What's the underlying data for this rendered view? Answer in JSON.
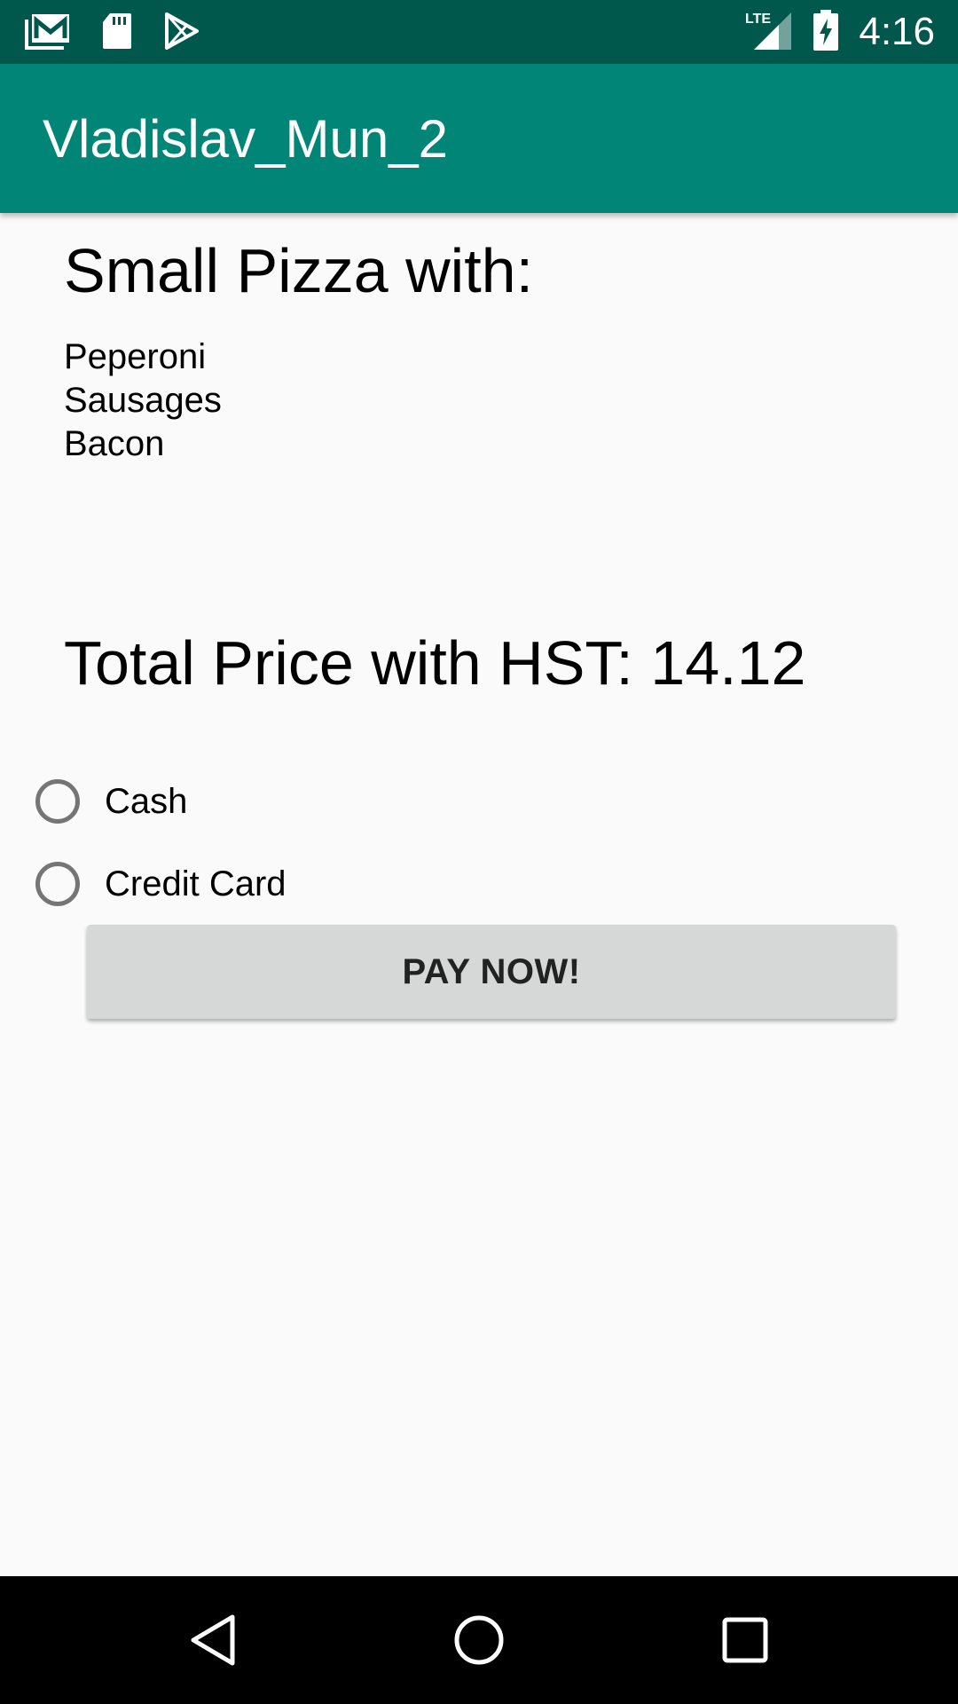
{
  "status_bar": {
    "time": "4:16",
    "network_label": "LTE",
    "left_icons": [
      "gmail-icon",
      "sd-card-icon",
      "play-store-icon"
    ],
    "right_icons": [
      "lte-signal-icon",
      "battery-charging-icon"
    ],
    "background_color": "#00574b"
  },
  "app_bar": {
    "title": "Vladislav_Mun_2",
    "background_color": "#008577"
  },
  "order": {
    "heading": "Small Pizza with:",
    "toppings": [
      "Peperoni",
      "Sausages",
      "Bacon"
    ],
    "total": "Total Price with HST: 14.12"
  },
  "payment": {
    "options": [
      {
        "label": "Cash",
        "selected": false
      },
      {
        "label": "Credit Card",
        "selected": false
      }
    ],
    "pay_button_label": "PAY NOW!"
  },
  "nav_bar": {
    "buttons": [
      "back-icon",
      "home-icon",
      "recents-icon"
    ]
  }
}
